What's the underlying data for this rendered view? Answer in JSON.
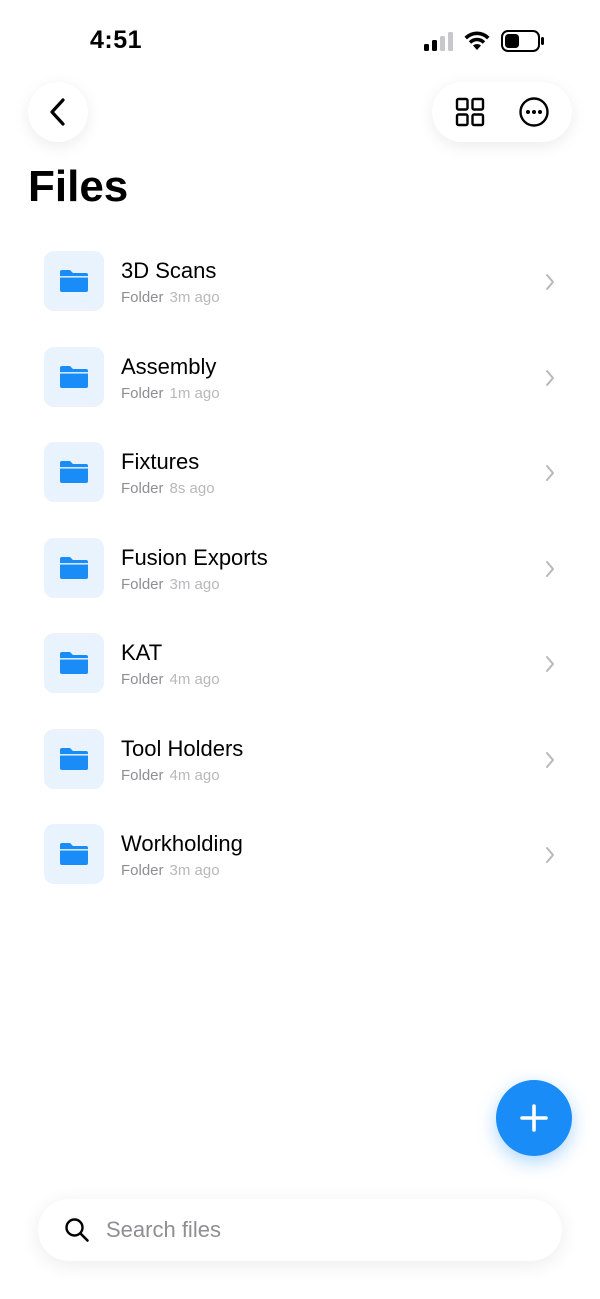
{
  "status_bar": {
    "time": "4:51"
  },
  "header": {
    "title": "Files"
  },
  "files": [
    {
      "name": "3D Scans",
      "kind": "Folder",
      "modified": "3m ago"
    },
    {
      "name": "Assembly",
      "kind": "Folder",
      "modified": "1m ago"
    },
    {
      "name": "Fixtures",
      "kind": "Folder",
      "modified": "8s ago"
    },
    {
      "name": "Fusion Exports",
      "kind": "Folder",
      "modified": "3m ago"
    },
    {
      "name": "KAT",
      "kind": "Folder",
      "modified": "4m ago"
    },
    {
      "name": "Tool Holders",
      "kind": "Folder",
      "modified": "4m ago"
    },
    {
      "name": "Workholding",
      "kind": "Folder",
      "modified": "3m ago"
    }
  ],
  "search": {
    "placeholder": "Search files"
  },
  "colors": {
    "accent": "#1a8cf7",
    "folder_tile": "#e8f3fe",
    "meta_text": "#8e8e93"
  },
  "icons": {
    "back": "chevron-left-icon",
    "grid": "grid-view-icon",
    "more": "more-options-icon",
    "folder": "folder-icon",
    "row_chevron": "chevron-right-icon",
    "add": "plus-icon",
    "search": "search-icon"
  }
}
